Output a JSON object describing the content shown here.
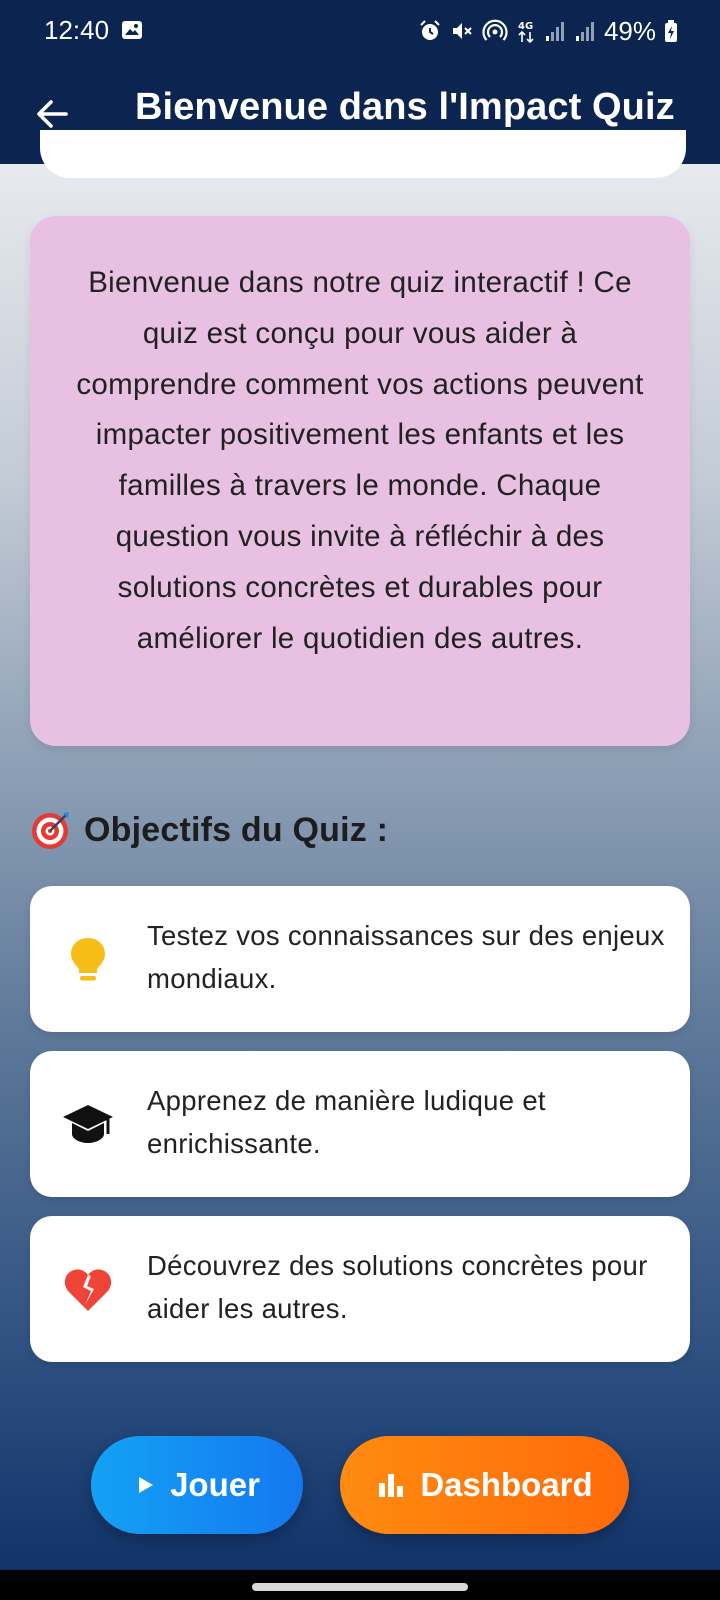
{
  "status_bar": {
    "time": "12:40",
    "battery_text": "49%",
    "icons": [
      "gallery-icon",
      "alarm-icon",
      "mute-icon",
      "hotspot-icon",
      "4g-icon",
      "signal-icon",
      "signal-icon",
      "battery-charging-icon"
    ]
  },
  "header": {
    "title": "Bienvenue dans l'Impact Quiz",
    "back_icon": "arrow-left-icon",
    "background": "#0b2550"
  },
  "intro": {
    "text": "Bienvenue dans notre quiz interactif ! Ce quiz est conçu pour vous aider à comprendre comment vos actions peuvent impacter positivement les enfants et les familles à travers le monde. Chaque question vous invite à réfléchir à des solutions concrètes et durables pour améliorer le quotidien des autres.",
    "background": "#e8c1e2"
  },
  "objectives": {
    "emoji": "🎯",
    "title": "Objectifs du Quiz :",
    "items": [
      {
        "icon": "lightbulb-icon",
        "text": "Testez vos connaissances sur des enjeux mondiaux."
      },
      {
        "icon": "graduation-cap-icon",
        "text": "Apprenez de manière ludique et enrichissante."
      },
      {
        "icon": "broken-heart-icon",
        "text": "Découvrez des solutions concrètes pour aider les autres."
      }
    ]
  },
  "actions": {
    "play_label": "Jouer",
    "play_icon": "play-icon",
    "dashboard_label": "Dashboard",
    "dashboard_icon": "bar-chart-icon"
  },
  "colors": {
    "play_button": "#1478f0",
    "dashboard_button": "#ff7a0d",
    "lightbulb": "#f5bd16",
    "broken_heart": "#f04438"
  }
}
